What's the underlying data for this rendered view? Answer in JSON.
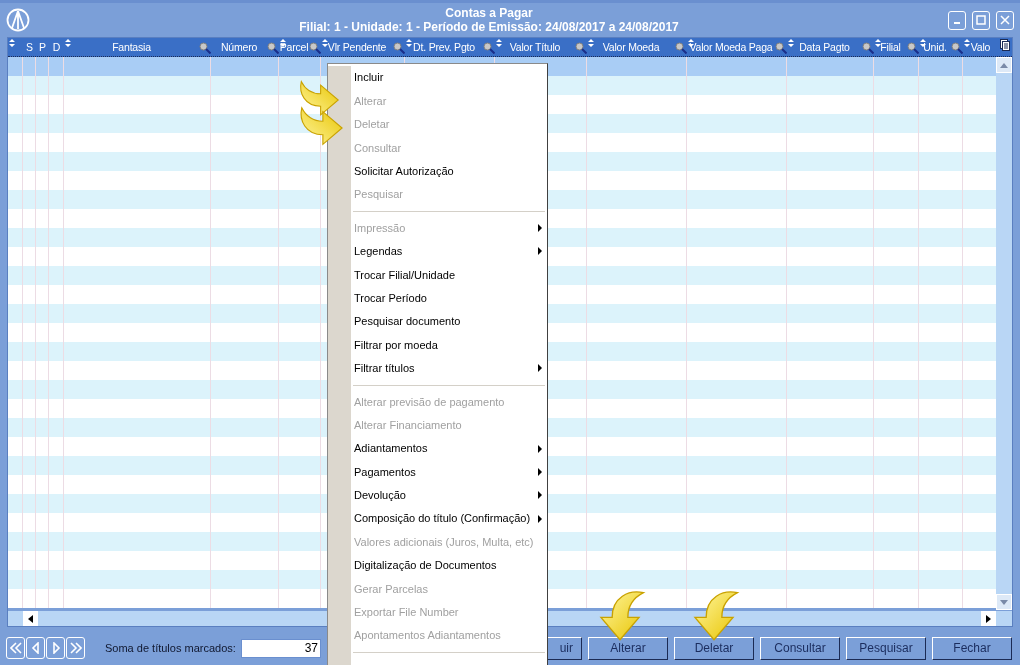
{
  "window": {
    "title": "Contas a Pagar",
    "subtitle": "Filial: 1 - Unidade: 1 - Período de Emissão: 24/08/2017 a 24/08/2017"
  },
  "table": {
    "columns": [
      {
        "sortable": true,
        "filter": false
      },
      {
        "label": "S",
        "sortable": false,
        "filter": false
      },
      {
        "label": "P",
        "sortable": false,
        "filter": false
      },
      {
        "label": "D",
        "sortable": false,
        "filter": false
      },
      {
        "label": "Fantasia",
        "sortable": true,
        "filter": true
      },
      {
        "label": "Número",
        "sortable": false,
        "filter": true
      },
      {
        "label": "Parcel",
        "sortable": true,
        "filter": true
      },
      {
        "label": "Vlr Pendente",
        "sortable": true,
        "filter": true
      },
      {
        "label": "Dt. Prev. Pgto",
        "sortable": true,
        "filter": true
      },
      {
        "label": "Valor Título",
        "sortable": true,
        "filter": true
      },
      {
        "label": "Valor Moeda",
        "sortable": true,
        "filter": true
      },
      {
        "label": "Valor Moeda Paga",
        "sortable": true,
        "filter": true
      },
      {
        "label": "Data Pagto",
        "sortable": true,
        "filter": true
      },
      {
        "label": "Filial",
        "sortable": true,
        "filter": true
      },
      {
        "label": "Unid.",
        "sortable": true,
        "filter": true
      },
      {
        "label": "Valo",
        "sortable": true,
        "filter": false
      }
    ],
    "rows": [
      {
        "selected": true
      },
      {
        "selected": false
      },
      {
        "selected": false
      },
      {
        "selected": false
      },
      {
        "selected": false
      },
      {
        "selected": false
      },
      {
        "selected": false
      },
      {
        "selected": false
      },
      {
        "selected": false
      },
      {
        "selected": false
      },
      {
        "selected": false
      },
      {
        "selected": false
      },
      {
        "selected": false
      },
      {
        "selected": false
      },
      {
        "selected": false
      },
      {
        "selected": false
      },
      {
        "selected": false
      },
      {
        "selected": false
      },
      {
        "selected": false
      },
      {
        "selected": false
      },
      {
        "selected": false
      },
      {
        "selected": false
      },
      {
        "selected": false
      },
      {
        "selected": false
      },
      {
        "selected": false
      },
      {
        "selected": false
      },
      {
        "selected": false
      },
      {
        "selected": false
      },
      {
        "selected": false
      }
    ]
  },
  "footer": {
    "sum_label": "Soma de títulos marcados:",
    "sum_value": "37",
    "buttons": [
      {
        "label": "uir"
      },
      {
        "label": "Alterar"
      },
      {
        "label": "Deletar"
      },
      {
        "label": "Consultar"
      },
      {
        "label": "Pesquisar"
      },
      {
        "label": "Fechar"
      }
    ]
  },
  "context_menu": {
    "items": [
      {
        "kind": "item",
        "label": "Incluir",
        "disabled": false,
        "submenu": false
      },
      {
        "kind": "item",
        "label": "Alterar",
        "disabled": true,
        "submenu": false
      },
      {
        "kind": "item",
        "label": "Deletar",
        "disabled": true,
        "submenu": false
      },
      {
        "kind": "item",
        "label": "Consultar",
        "disabled": true,
        "submenu": false
      },
      {
        "kind": "item",
        "label": "Solicitar Autorização",
        "disabled": false,
        "submenu": false
      },
      {
        "kind": "item",
        "label": "Pesquisar",
        "disabled": true,
        "submenu": false
      },
      {
        "kind": "separator"
      },
      {
        "kind": "item",
        "label": "Impressão",
        "disabled": true,
        "submenu": true
      },
      {
        "kind": "item",
        "label": "Legendas",
        "disabled": false,
        "submenu": true
      },
      {
        "kind": "item",
        "label": "Trocar Filial/Unidade",
        "disabled": false,
        "submenu": false
      },
      {
        "kind": "item",
        "label": "Trocar Período",
        "disabled": false,
        "submenu": false
      },
      {
        "kind": "item",
        "label": "Pesquisar documento",
        "disabled": false,
        "submenu": false
      },
      {
        "kind": "item",
        "label": "Filtrar por moeda",
        "disabled": false,
        "submenu": false
      },
      {
        "kind": "item",
        "label": "Filtrar títulos",
        "disabled": false,
        "submenu": true
      },
      {
        "kind": "separator"
      },
      {
        "kind": "item",
        "label": "Alterar previsão de pagamento",
        "disabled": true,
        "submenu": false
      },
      {
        "kind": "item",
        "label": "Alterar Financiamento",
        "disabled": true,
        "submenu": false
      },
      {
        "kind": "item",
        "label": "Adiantamentos",
        "disabled": false,
        "submenu": true
      },
      {
        "kind": "item",
        "label": "Pagamentos",
        "disabled": false,
        "submenu": true
      },
      {
        "kind": "item",
        "label": "Devolução",
        "disabled": false,
        "submenu": true
      },
      {
        "kind": "item",
        "label": "Composição do título (Confirmação)",
        "disabled": false,
        "submenu": true
      },
      {
        "kind": "item",
        "label": "Valores adicionais (Juros, Multa, etc)",
        "disabled": true,
        "submenu": false
      },
      {
        "kind": "item",
        "label": "Digitalização de Documentos",
        "disabled": false,
        "submenu": false
      },
      {
        "kind": "item",
        "label": "Gerar Parcelas",
        "disabled": true,
        "submenu": false
      },
      {
        "kind": "item",
        "label": "Exportar File Number",
        "disabled": true,
        "submenu": false
      },
      {
        "kind": "item",
        "label": "Apontamentos Adiantamentos",
        "disabled": true,
        "submenu": false
      },
      {
        "kind": "separator"
      }
    ]
  }
}
